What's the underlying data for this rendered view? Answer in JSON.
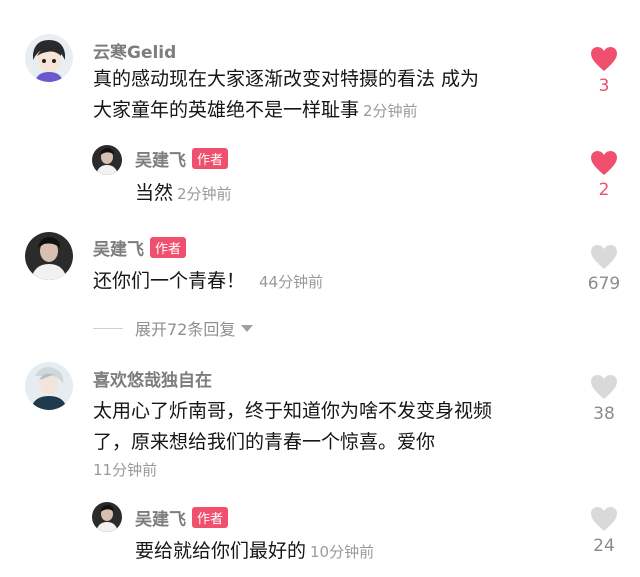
{
  "comments": [
    {
      "user": "云寒Gelid",
      "text": "真的感动现在大家逐渐改变对特摄的看法 成为大家童年的英雄绝不是一样耻事",
      "line1": "真的感动现在大家逐渐改变对特摄的看法 成为",
      "line2": "大家童年的英雄绝不是一样耻事",
      "time": "2分钟前",
      "likes": "3",
      "liked": true,
      "replies": [
        {
          "user": "吴建飞",
          "badge": "作者",
          "text": "当然",
          "time": "2分钟前",
          "likes": "2",
          "liked": true
        }
      ]
    },
    {
      "user": "吴建飞",
      "badge": "作者",
      "text": "还你们一个青春！",
      "time": "44分钟前",
      "likes": "679",
      "liked": false,
      "expand_label": "展开72条回复"
    },
    {
      "user": "喜欢悠哉独自在",
      "line1": "太用心了炘南哥，终于知道你为啥不发变身视频",
      "line2": "了，原来想给我们的青春一个惊喜。爱你",
      "time": "11分钟前",
      "likes": "38",
      "liked": false,
      "replies": [
        {
          "user": "吴建飞",
          "badge": "作者",
          "text": "要给就给你们最好的",
          "time": "10分钟前",
          "likes": "24",
          "liked": false
        }
      ]
    }
  ],
  "colors": {
    "like_active": "#f0506e",
    "like_inactive": "#d9d9d9",
    "badge_bg": "#f0506e"
  },
  "icons": {
    "like": "heart-icon",
    "expand": "triangle-down-icon"
  }
}
